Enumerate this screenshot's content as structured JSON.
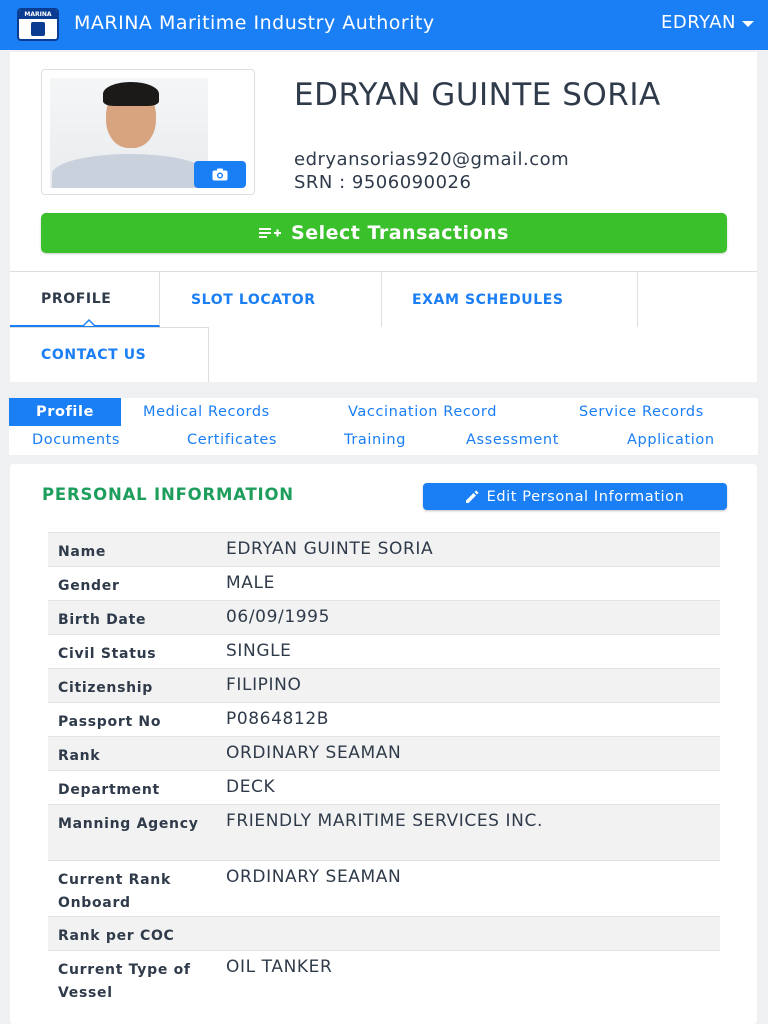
{
  "header": {
    "logo_text": "MARINA",
    "app_title": "MARINA Maritime Industry Authority",
    "user": "EDRYAN"
  },
  "profile": {
    "full_name": "EDRYAN GUINTE SORIA",
    "email": "edryansorias920@gmail.com",
    "srn": "SRN : 9506090026",
    "select_transactions": "Select Transactions"
  },
  "nav_tabs": [
    "PROFILE",
    "SLOT LOCATOR",
    "EXAM SCHEDULES",
    "CONTACT US"
  ],
  "sub_tabs": [
    "Profile",
    "Medical Records",
    "Vaccination Record",
    "Service Records",
    "Documents",
    "Certificates",
    "Training",
    "Assessment",
    "Application"
  ],
  "personal_info": {
    "section_title": "PERSONAL INFORMATION",
    "edit_button": "Edit Personal Information",
    "rows": [
      {
        "label": "Name",
        "value": "EDRYAN GUINTE SORIA"
      },
      {
        "label": "Gender",
        "value": "MALE"
      },
      {
        "label": "Birth Date",
        "value": "06/09/1995"
      },
      {
        "label": "Civil Status",
        "value": "SINGLE"
      },
      {
        "label": "Citizenship",
        "value": "FILIPINO"
      },
      {
        "label": "Passport No",
        "value": "P0864812B"
      },
      {
        "label": "Rank",
        "value": "ORDINARY SEAMAN"
      },
      {
        "label": "Department",
        "value": "DECK"
      },
      {
        "label": "Manning Agency",
        "value": "FRIENDLY MARITIME SERVICES INC."
      },
      {
        "label": "Current Rank Onboard",
        "value": "ORDINARY SEAMAN"
      },
      {
        "label": "Rank per COC",
        "value": ""
      },
      {
        "label": "Current Type of Vessel",
        "value": "OIL TANKER"
      }
    ]
  },
  "colors": {
    "primary": "#1a7ef5",
    "success": "#3ac02b",
    "section_title": "#1e9e5c"
  }
}
